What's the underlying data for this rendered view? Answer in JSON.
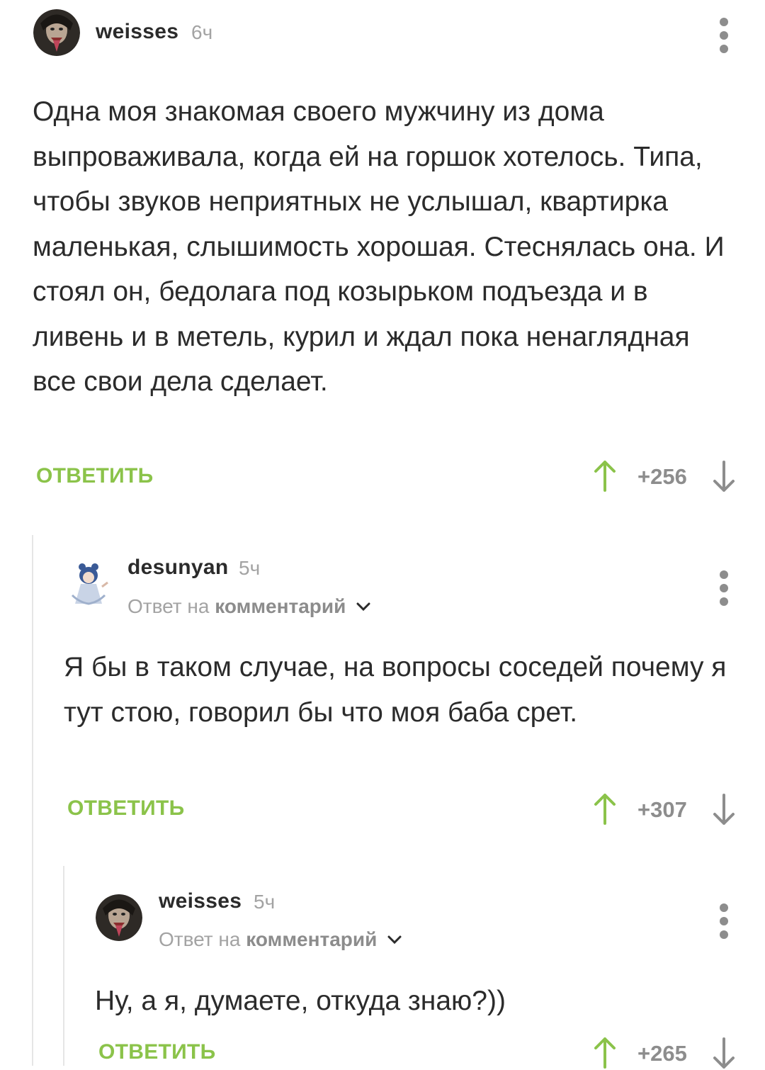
{
  "comments": [
    {
      "username": "weisses",
      "time": "6ч",
      "reply_to": null,
      "text": "Одна моя знакомая своего мужчину из дома выпроваживала, когда ей на горшок хотелось. Типа, чтобы звуков неприятных не услышал, квартирка маленькая, слышимость хорошая. Стеснялась она. И стоял он, бедолага под козырьком подъезда и в ливень и в метель, курил и ждал пока ненаглядная все свои дела сделает.",
      "reply_label": "ОТВЕТИТЬ",
      "score": "+256"
    },
    {
      "username": "desunyan",
      "time": "5ч",
      "reply_to": {
        "prefix": "Ответ на",
        "target": "комментарий"
      },
      "text": "Я бы в таком случае, на вопросы соседей почему я тут стою, говорил бы что моя баба срет.",
      "reply_label": "ОТВЕТИТЬ",
      "score": "+307"
    },
    {
      "username": "weisses",
      "time": "5ч",
      "reply_to": {
        "prefix": "Ответ на",
        "target": "комментарий"
      },
      "text": "Ну, а я, думаете, откуда знаю?))",
      "reply_label": "ОТВЕТИТЬ",
      "score": "+265"
    }
  ],
  "colors": {
    "accent": "#8bc34a",
    "text": "#2b2b2b",
    "muted": "#a3a3a3",
    "line": "#e6e6e6"
  }
}
